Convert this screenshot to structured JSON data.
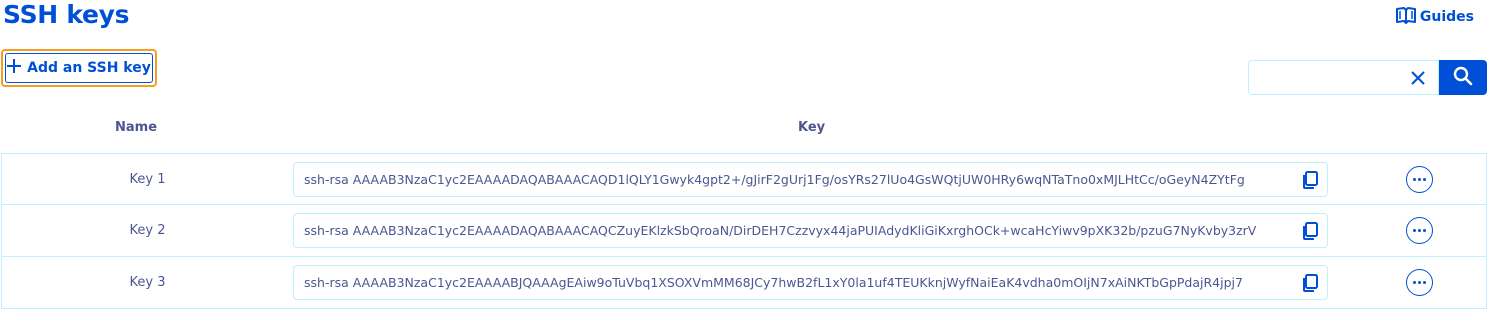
{
  "page": {
    "title": "SSH keys",
    "guides_label": "Guides"
  },
  "toolbar": {
    "add_label": "Add an SSH key"
  },
  "search": {
    "value": "",
    "placeholder": ""
  },
  "table": {
    "headers": {
      "name": "Name",
      "key": "Key"
    },
    "rows": [
      {
        "name": "Key 1",
        "key": "ssh-rsa AAAAB3NzaC1yc2EAAAADAQABAAACAQD1lQLY1Gwyk4gpt2+/gJirF2gUrj1Fg/osYRs27lUo4GsWQtjUW0HRy6wqNTaTno0xMJLHtCc/oGeyN4ZYtFg"
      },
      {
        "name": "Key 2",
        "key": "ssh-rsa AAAAB3NzaC1yc2EAAAADAQABAAACAQCZuyEKlzkSbQroaN/DirDEH7Czzvyx44jaPUIAdydKliGiKxrghOCk+wcaHcYiwv9pXK32b/pzuG7NyKvby3zrV"
      },
      {
        "name": "Key 3",
        "key": "ssh-rsa AAAAB3NzaC1yc2EAAAABJQAAAgEAiw9oTuVbq1XSOXVmMM68JCy7hwB2fL1xY0la1uf4TEUKknjWyfNaiEaK4vdha0mOIjN7xAiNKTbGpPdajR4jpj7"
      }
    ]
  },
  "colors": {
    "primary": "#0050d7",
    "text": "#4d5693",
    "border": "#bef1ff",
    "focus": "#f99d1c"
  },
  "icons": {
    "guides": "book-icon",
    "add": "plus-icon",
    "clear": "close-icon",
    "search": "search-icon",
    "copy": "copy-icon",
    "more": "more-icon"
  }
}
